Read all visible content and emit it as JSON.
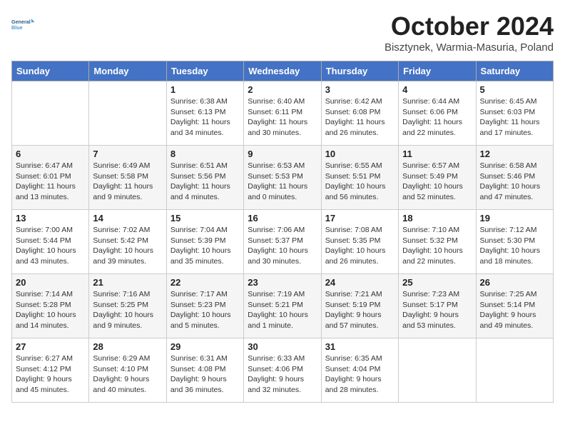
{
  "header": {
    "logo_line1": "General",
    "logo_line2": "Blue",
    "month_title": "October 2024",
    "location": "Bisztynek, Warmia-Masuria, Poland"
  },
  "weekdays": [
    "Sunday",
    "Monday",
    "Tuesday",
    "Wednesday",
    "Thursday",
    "Friday",
    "Saturday"
  ],
  "weeks": [
    [
      {
        "day": "",
        "info": ""
      },
      {
        "day": "",
        "info": ""
      },
      {
        "day": "1",
        "info": "Sunrise: 6:38 AM\nSunset: 6:13 PM\nDaylight: 11 hours and 34 minutes."
      },
      {
        "day": "2",
        "info": "Sunrise: 6:40 AM\nSunset: 6:11 PM\nDaylight: 11 hours and 30 minutes."
      },
      {
        "day": "3",
        "info": "Sunrise: 6:42 AM\nSunset: 6:08 PM\nDaylight: 11 hours and 26 minutes."
      },
      {
        "day": "4",
        "info": "Sunrise: 6:44 AM\nSunset: 6:06 PM\nDaylight: 11 hours and 22 minutes."
      },
      {
        "day": "5",
        "info": "Sunrise: 6:45 AM\nSunset: 6:03 PM\nDaylight: 11 hours and 17 minutes."
      }
    ],
    [
      {
        "day": "6",
        "info": "Sunrise: 6:47 AM\nSunset: 6:01 PM\nDaylight: 11 hours and 13 minutes."
      },
      {
        "day": "7",
        "info": "Sunrise: 6:49 AM\nSunset: 5:58 PM\nDaylight: 11 hours and 9 minutes."
      },
      {
        "day": "8",
        "info": "Sunrise: 6:51 AM\nSunset: 5:56 PM\nDaylight: 11 hours and 4 minutes."
      },
      {
        "day": "9",
        "info": "Sunrise: 6:53 AM\nSunset: 5:53 PM\nDaylight: 11 hours and 0 minutes."
      },
      {
        "day": "10",
        "info": "Sunrise: 6:55 AM\nSunset: 5:51 PM\nDaylight: 10 hours and 56 minutes."
      },
      {
        "day": "11",
        "info": "Sunrise: 6:57 AM\nSunset: 5:49 PM\nDaylight: 10 hours and 52 minutes."
      },
      {
        "day": "12",
        "info": "Sunrise: 6:58 AM\nSunset: 5:46 PM\nDaylight: 10 hours and 47 minutes."
      }
    ],
    [
      {
        "day": "13",
        "info": "Sunrise: 7:00 AM\nSunset: 5:44 PM\nDaylight: 10 hours and 43 minutes."
      },
      {
        "day": "14",
        "info": "Sunrise: 7:02 AM\nSunset: 5:42 PM\nDaylight: 10 hours and 39 minutes."
      },
      {
        "day": "15",
        "info": "Sunrise: 7:04 AM\nSunset: 5:39 PM\nDaylight: 10 hours and 35 minutes."
      },
      {
        "day": "16",
        "info": "Sunrise: 7:06 AM\nSunset: 5:37 PM\nDaylight: 10 hours and 30 minutes."
      },
      {
        "day": "17",
        "info": "Sunrise: 7:08 AM\nSunset: 5:35 PM\nDaylight: 10 hours and 26 minutes."
      },
      {
        "day": "18",
        "info": "Sunrise: 7:10 AM\nSunset: 5:32 PM\nDaylight: 10 hours and 22 minutes."
      },
      {
        "day": "19",
        "info": "Sunrise: 7:12 AM\nSunset: 5:30 PM\nDaylight: 10 hours and 18 minutes."
      }
    ],
    [
      {
        "day": "20",
        "info": "Sunrise: 7:14 AM\nSunset: 5:28 PM\nDaylight: 10 hours and 14 minutes."
      },
      {
        "day": "21",
        "info": "Sunrise: 7:16 AM\nSunset: 5:25 PM\nDaylight: 10 hours and 9 minutes."
      },
      {
        "day": "22",
        "info": "Sunrise: 7:17 AM\nSunset: 5:23 PM\nDaylight: 10 hours and 5 minutes."
      },
      {
        "day": "23",
        "info": "Sunrise: 7:19 AM\nSunset: 5:21 PM\nDaylight: 10 hours and 1 minute."
      },
      {
        "day": "24",
        "info": "Sunrise: 7:21 AM\nSunset: 5:19 PM\nDaylight: 9 hours and 57 minutes."
      },
      {
        "day": "25",
        "info": "Sunrise: 7:23 AM\nSunset: 5:17 PM\nDaylight: 9 hours and 53 minutes."
      },
      {
        "day": "26",
        "info": "Sunrise: 7:25 AM\nSunset: 5:14 PM\nDaylight: 9 hours and 49 minutes."
      }
    ],
    [
      {
        "day": "27",
        "info": "Sunrise: 6:27 AM\nSunset: 4:12 PM\nDaylight: 9 hours and 45 minutes."
      },
      {
        "day": "28",
        "info": "Sunrise: 6:29 AM\nSunset: 4:10 PM\nDaylight: 9 hours and 40 minutes."
      },
      {
        "day": "29",
        "info": "Sunrise: 6:31 AM\nSunset: 4:08 PM\nDaylight: 9 hours and 36 minutes."
      },
      {
        "day": "30",
        "info": "Sunrise: 6:33 AM\nSunset: 4:06 PM\nDaylight: 9 hours and 32 minutes."
      },
      {
        "day": "31",
        "info": "Sunrise: 6:35 AM\nSunset: 4:04 PM\nDaylight: 9 hours and 28 minutes."
      },
      {
        "day": "",
        "info": ""
      },
      {
        "day": "",
        "info": ""
      }
    ]
  ]
}
